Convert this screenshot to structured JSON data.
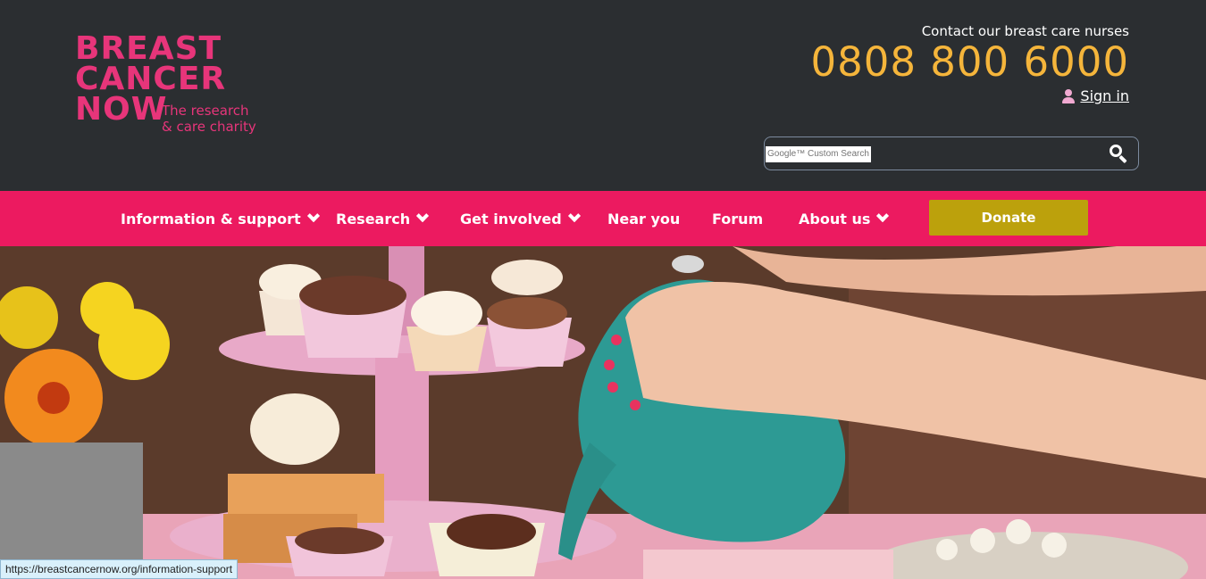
{
  "brand": {
    "logo_lines": [
      "BREAST",
      "CANCER",
      "NOW"
    ],
    "tagline_lines": [
      "The research",
      "& care charity"
    ],
    "accent_pink": "#e7357a",
    "nav_pink": "#ec1a60",
    "phone_color": "#f5b53b",
    "donate_color": "#bca10c",
    "header_bg": "#2b2e31"
  },
  "header": {
    "contact_label": "Contact our breast care nurses",
    "phone": "0808 800 6000",
    "signin_label": "Sign in",
    "signin_icon": "user-icon"
  },
  "search": {
    "placeholder": "Google™ Custom Search",
    "button_icon": "search-icon"
  },
  "nav": {
    "items": [
      {
        "label": "Information & support",
        "has_dropdown": true
      },
      {
        "label": "Research",
        "has_dropdown": true
      },
      {
        "label": "Get involved",
        "has_dropdown": true
      },
      {
        "label": "Near you",
        "has_dropdown": false
      },
      {
        "label": "Forum",
        "has_dropdown": false
      },
      {
        "label": "About us",
        "has_dropdown": true
      }
    ],
    "donate_label": "Donate"
  },
  "status_bar": {
    "url": "https://breastcancernow.org/information-support"
  }
}
